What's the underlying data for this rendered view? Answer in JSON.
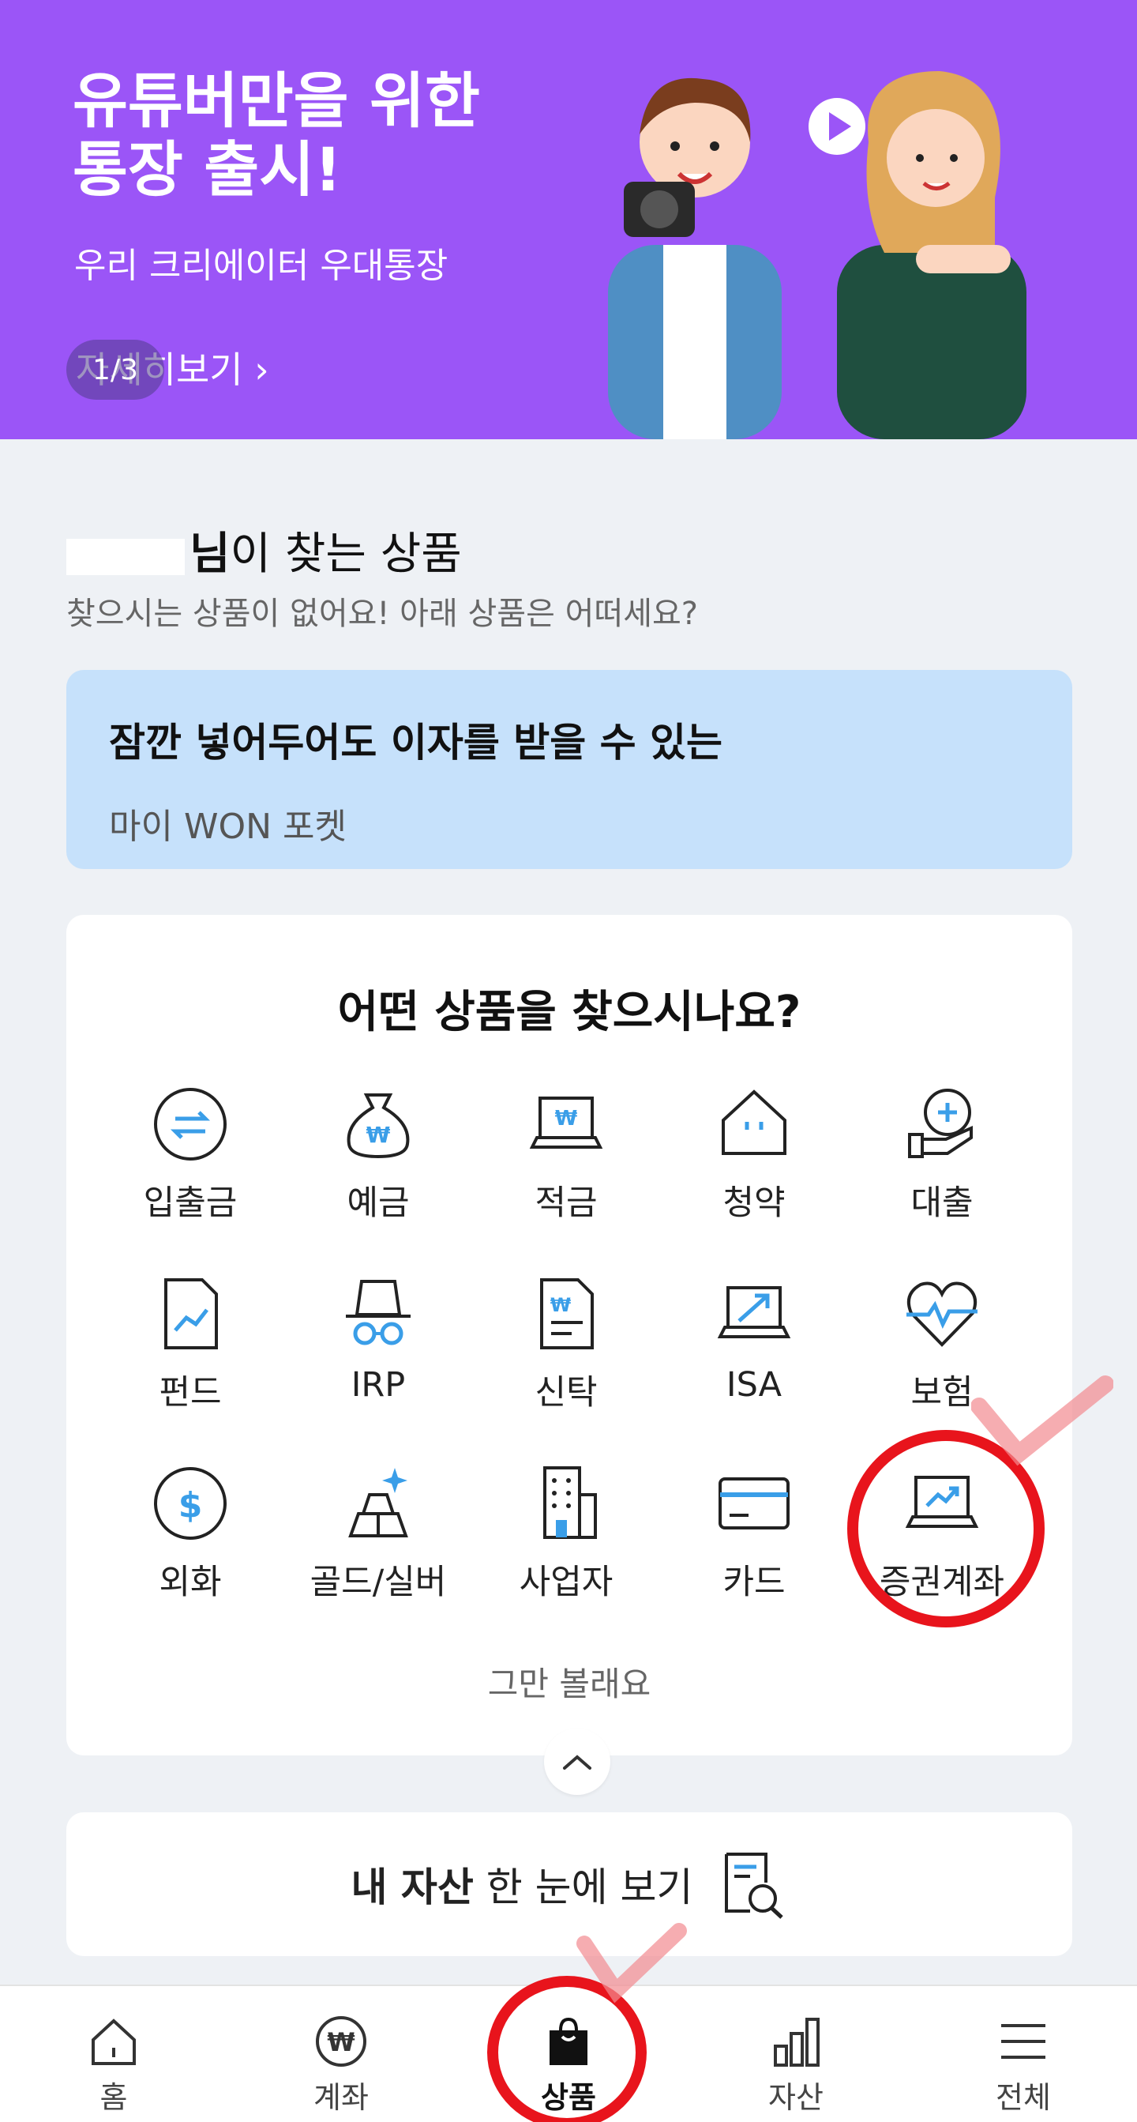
{
  "banner": {
    "title_line1": "유튜버만을 위한",
    "title_line2": "통장 출시!",
    "subtitle": "우리 크리에이터 우대통장",
    "more_link": "자세히보기",
    "counter": "1/3",
    "background_color": "#9b55f7"
  },
  "recommend": {
    "title_suffix": "님",
    "title_rest": "이 찾는 상품",
    "subtitle": "찾으시는 상품이 없어요! 아래 상품은 어떠세요?"
  },
  "pocket_card": {
    "headline": "잠깐 넣어두어도 이자를 받을 수 있는",
    "product": "마이 WON 포켓",
    "background_color": "#c6e1fb"
  },
  "product_grid": {
    "title": "어떤 상품을 찾으시나요?",
    "items": [
      {
        "label": "입출금",
        "icon": "transfer-icon"
      },
      {
        "label": "예금",
        "icon": "money-bag-icon"
      },
      {
        "label": "적금",
        "icon": "laptop-won-icon"
      },
      {
        "label": "청약",
        "icon": "house-icon"
      },
      {
        "label": "대출",
        "icon": "hand-plus-icon"
      },
      {
        "label": "펀드",
        "icon": "document-chart-icon"
      },
      {
        "label": "IRP",
        "icon": "hat-glasses-icon"
      },
      {
        "label": "신탁",
        "icon": "document-won-icon"
      },
      {
        "label": "ISA",
        "icon": "laptop-arrow-icon"
      },
      {
        "label": "보험",
        "icon": "heart-pulse-icon"
      },
      {
        "label": "외화",
        "icon": "dollar-coin-icon"
      },
      {
        "label": "골드/실버",
        "icon": "gold-bars-icon"
      },
      {
        "label": "사업자",
        "icon": "building-icon"
      },
      {
        "label": "카드",
        "icon": "card-icon"
      },
      {
        "label": "증권계좌",
        "icon": "laptop-chart-icon"
      }
    ],
    "stop_label": "그만 볼래요"
  },
  "asset_card": {
    "bold_part": "내 자산",
    "rest": " 한 눈에 보기"
  },
  "bottom_nav": {
    "items": [
      {
        "label": "홈",
        "icon": "home-icon"
      },
      {
        "label": "계좌",
        "icon": "won-coin-icon"
      },
      {
        "label": "상품",
        "icon": "shopping-bag-icon"
      },
      {
        "label": "자산",
        "icon": "bar-chart-icon"
      },
      {
        "label": "전체",
        "icon": "menu-icon"
      }
    ],
    "active": "상품"
  },
  "colors": {
    "accent_blue": "#3a9ee8",
    "annotation_red": "#e8141c"
  }
}
